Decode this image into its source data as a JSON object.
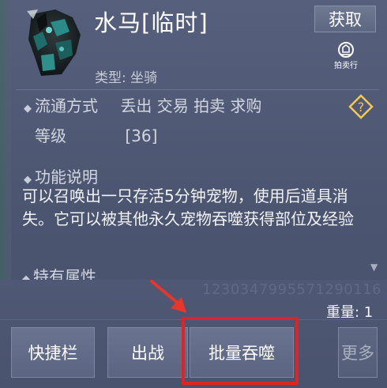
{
  "item": {
    "name": "水马[临时]",
    "type_label": "类型: 坐骑"
  },
  "actions": {
    "get_label": "获取",
    "auction_label": "拍卖行"
  },
  "circulation": {
    "label": "流通方式",
    "value": "丢出 交易 拍卖 求购"
  },
  "level": {
    "label": "等级",
    "value": "[36]"
  },
  "function_desc": {
    "label": "功能说明",
    "text": "可以召唤出一只存活5分钟宠物，使用后道具消失。它可以被其他永久宠物吞噬获得部位及经验"
  },
  "special_attr": {
    "label": "特有属性"
  },
  "serial": "1230347995571290116",
  "weight": "重量: 1",
  "buttons": {
    "quickbar": "快捷栏",
    "deploy": "出战",
    "batch_devour": "批量吞噬",
    "more": "更多"
  },
  "colors": {
    "panel_bg": "#4f5874",
    "highlight_border": "#e02424",
    "arrow": "#e8362a"
  }
}
